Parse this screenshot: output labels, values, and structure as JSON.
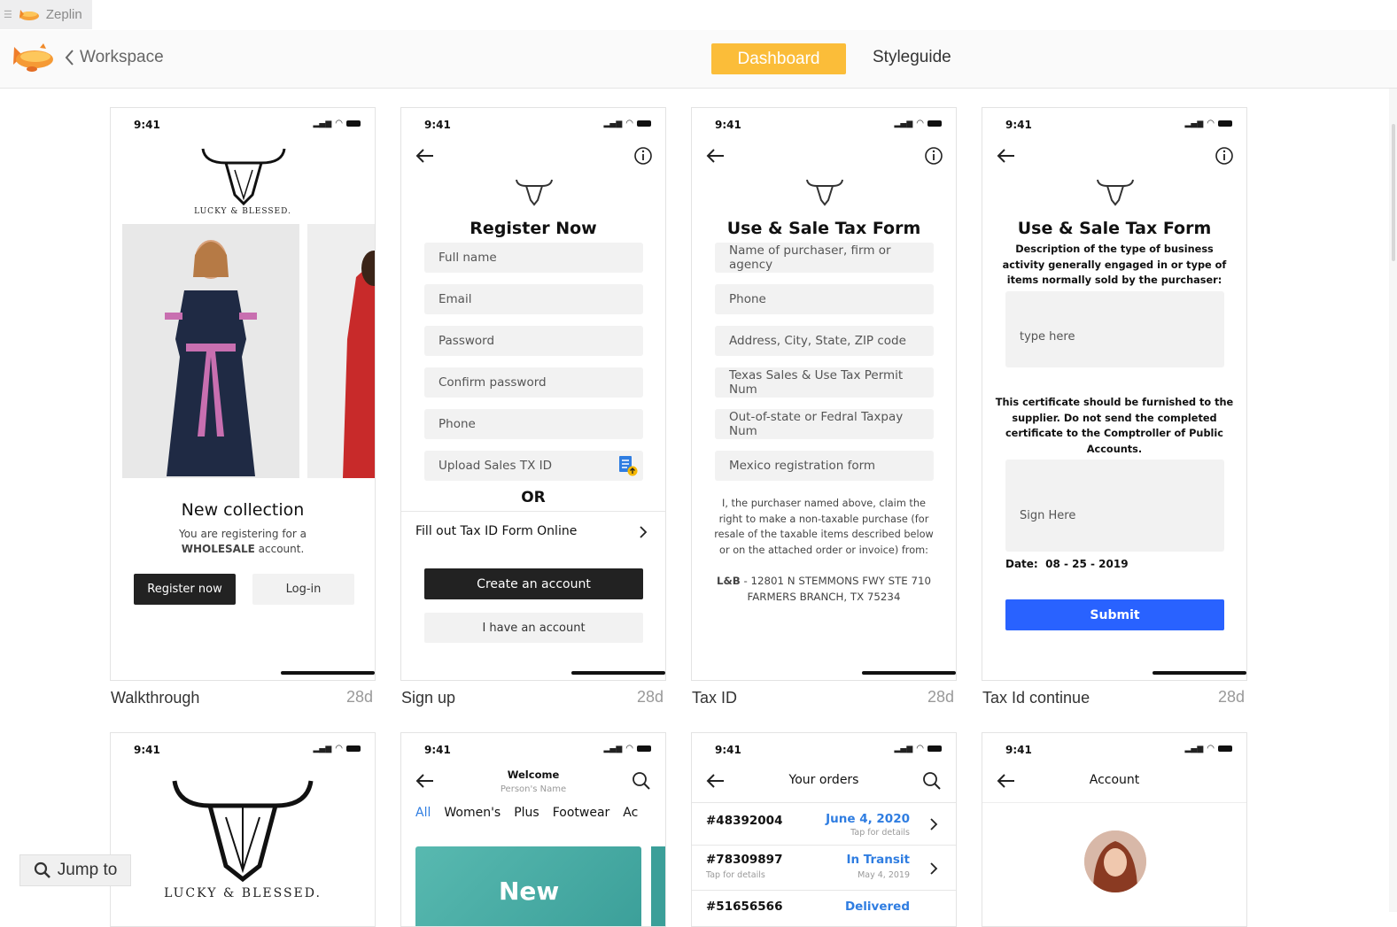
{
  "window": {
    "tab_title": "Zeplin"
  },
  "topbar": {
    "back_label": "Workspace",
    "tab_dashboard": "Dashboard",
    "tab_styleguide": "Styleguide",
    "accent": "#fbbd39"
  },
  "status_time": "9:41",
  "brand_text": "LUCKY & BLESSED.",
  "screens": [
    {
      "name": "Walkthrough",
      "age": "28d"
    },
    {
      "name": "Sign up",
      "age": "28d"
    },
    {
      "name": "Tax ID",
      "age": "28d"
    },
    {
      "name": "Tax Id continue",
      "age": "28d"
    }
  ],
  "walkthrough": {
    "title": "New collection",
    "subtitle_1": "You are registering for a",
    "subtitle_bold": "WHOLESALE",
    "subtitle_2": " account.",
    "btn_register": "Register now",
    "btn_login": "Log-in"
  },
  "signup": {
    "title": "Register Now",
    "fields": [
      "Full name",
      "Email",
      "Password",
      "Confirm password",
      "Phone",
      "Upload Sales TX ID"
    ],
    "or": "OR",
    "fill_online": "Fill out Tax ID Form Online",
    "btn_create": "Create an account",
    "btn_have": "I have an account"
  },
  "taxid": {
    "title": "Use & Sale Tax Form",
    "fields": [
      "Name of purchaser, firm or agency",
      "Phone",
      "Address, City, State, ZIP code",
      "Texas Sales & Use Tax Permit Num",
      "Out-of-state or Fedral Taxpay Num",
      "Mexico registration form"
    ],
    "claim_1": "I, the purchaser named above, claim the",
    "claim_2": "right to make a non-taxable purchase (for",
    "claim_3": "resale of the taxable items described below",
    "claim_4": "or on the attached order or invoice) from:",
    "addr_bold": "L&B",
    "addr_1": " - 12801 N STEMMONS FWY STE 710",
    "addr_2": "FARMERS BRANCH, TX 75234"
  },
  "taxcont": {
    "title": "Use & Sale Tax Form",
    "desc_1": "Description of the type of business",
    "desc_2": "activity generally engaged in or type of",
    "desc_3": "items normally sold by the purchaser:",
    "type_placeholder": "type here",
    "cert_1": "This certificate should be furnished to the",
    "cert_2": "supplier. Do not send the completed",
    "cert_3": "certificate to the Comptroller of Public",
    "cert_4": "Accounts.",
    "sign_placeholder": "Sign Here",
    "date_label": "Date:",
    "date_value": "08 - 25 - 2019",
    "btn_submit": "Submit",
    "submit_color": "#2962ff"
  },
  "home": {
    "welcome": "Welcome",
    "person": "Person's Name",
    "cats": [
      "All",
      "Women's",
      "Plus",
      "Footwear",
      "Ac"
    ],
    "banner": "New"
  },
  "orders": {
    "title": "Your orders",
    "items": [
      {
        "id": "#48392004",
        "status": "June 4, 2020",
        "sub": "Tap for details"
      },
      {
        "id": "#78309897",
        "status": "In Transit",
        "sub": "Tap for details",
        "date": "May 4, 2019"
      },
      {
        "id": "#51656566",
        "status": "Delivered"
      }
    ]
  },
  "account": {
    "title": "Account"
  },
  "jump_to": "Jump to"
}
